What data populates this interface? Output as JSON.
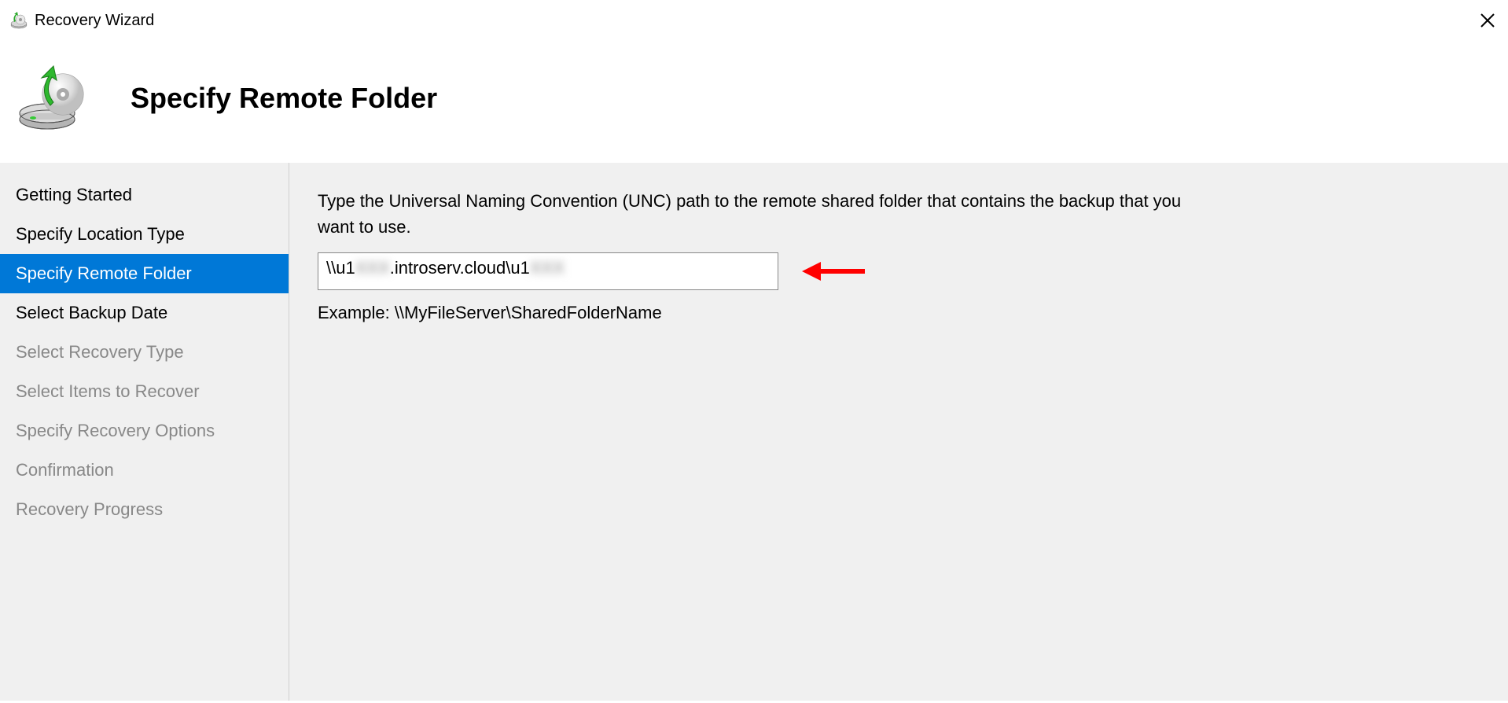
{
  "window": {
    "title": "Recovery Wizard"
  },
  "header": {
    "title": "Specify Remote Folder"
  },
  "sidebar": {
    "items": [
      {
        "label": "Getting Started",
        "state": "active"
      },
      {
        "label": "Specify Location Type",
        "state": "active"
      },
      {
        "label": "Specify Remote Folder",
        "state": "selected"
      },
      {
        "label": "Select Backup Date",
        "state": "active"
      },
      {
        "label": "Select Recovery Type",
        "state": "disabled"
      },
      {
        "label": "Select Items to Recover",
        "state": "disabled"
      },
      {
        "label": "Specify Recovery Options",
        "state": "disabled"
      },
      {
        "label": "Confirmation",
        "state": "disabled"
      },
      {
        "label": "Recovery Progress",
        "state": "disabled"
      }
    ]
  },
  "main": {
    "instruction": "Type the Universal Naming Convention (UNC) path to the remote shared folder that contains the backup that you want to use.",
    "input": {
      "seg1": "\\\\u1",
      "seg2_redacted": "XXX",
      "seg3": ".introserv.cloud\\u1",
      "seg4_redacted": "XXX"
    },
    "example": "Example: \\\\MyFileServer\\SharedFolderName"
  },
  "annotation": {
    "arrow_color": "#ff0000"
  }
}
